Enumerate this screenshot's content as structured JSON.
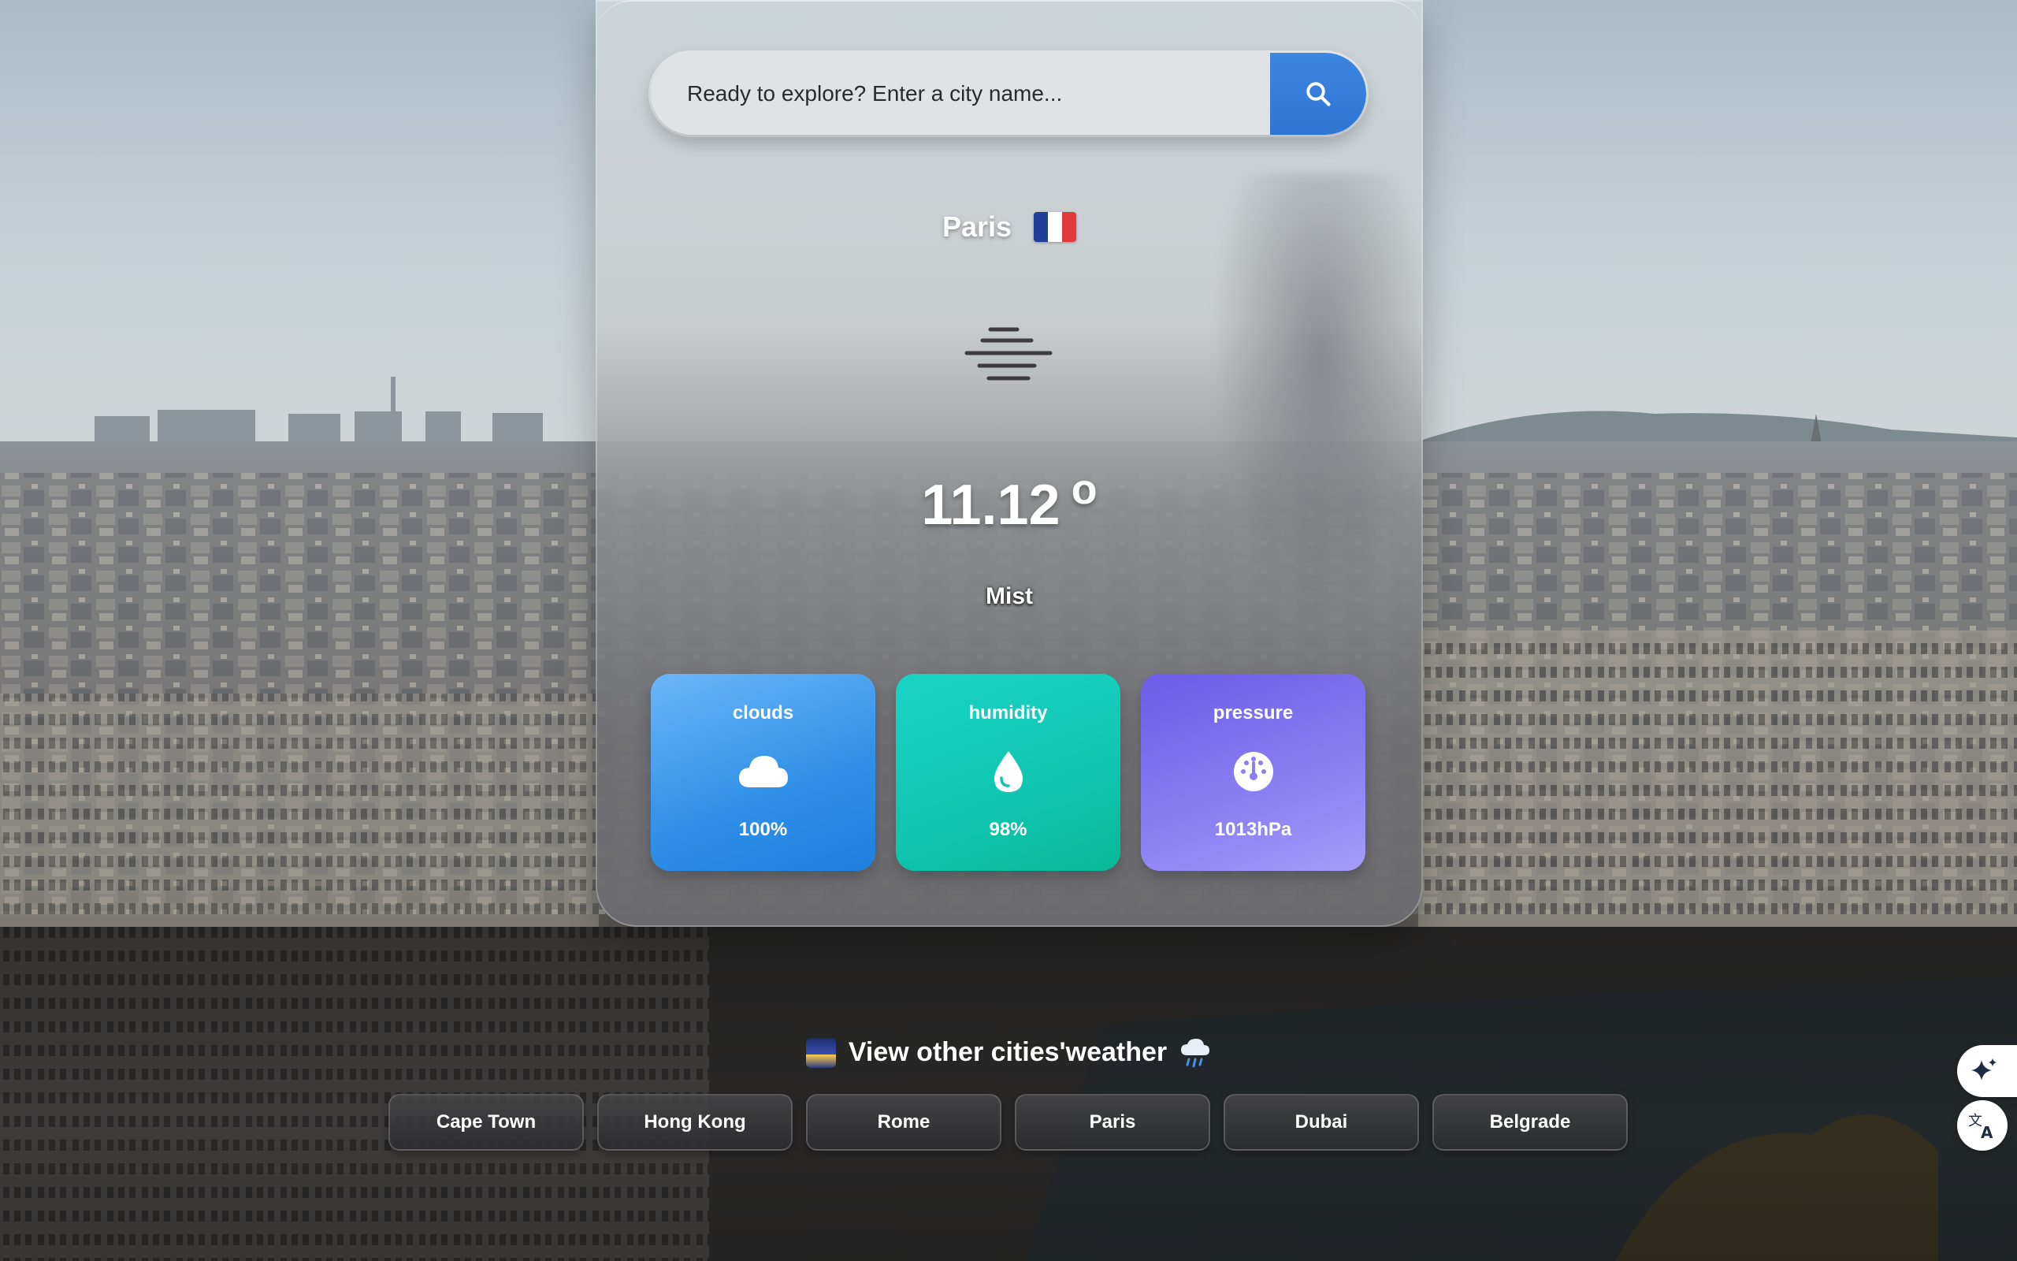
{
  "search": {
    "placeholder": "Ready to explore? Enter a city name..."
  },
  "current": {
    "city": "Paris",
    "temperature": "11.12",
    "degree_symbol": "o",
    "description": "Mist",
    "icon": "mist-icon"
  },
  "stats": [
    {
      "label": "clouds",
      "value": "100%",
      "icon": "cloud-icon",
      "color": "#2f8fe8"
    },
    {
      "label": "humidity",
      "value": "98%",
      "icon": "droplet-icon",
      "color": "#0fc6b0"
    },
    {
      "label": "pressure",
      "value": "1013hPa",
      "icon": "gauge-icon",
      "color": "#8b7ff2"
    }
  ],
  "other_cities": {
    "title": "View other cities'weather",
    "cities": [
      "Cape Town",
      "Hong Kong",
      "Rome",
      "Paris",
      "Dubai",
      "Belgrade"
    ]
  },
  "colors": {
    "accent": "#2f75d4",
    "flag_blue": "#1f3f9a",
    "flag_white": "#ffffff",
    "flag_red": "#e23a3a"
  }
}
